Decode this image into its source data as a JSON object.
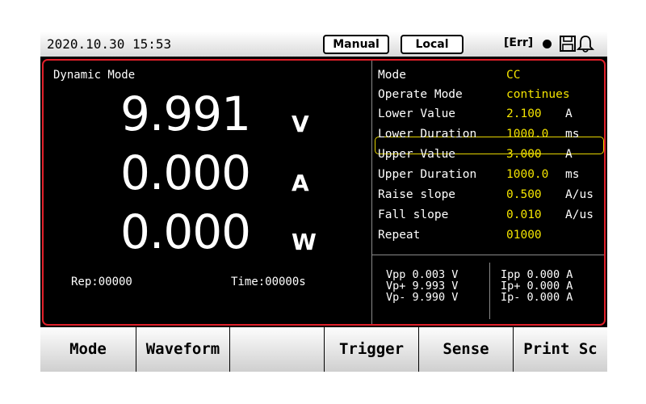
{
  "status_bar": {
    "datetime": "2020.10.30 15:53",
    "control_mode": "Manual",
    "location": "Local",
    "error": "[Err]"
  },
  "panel": {
    "title": "Dynamic Mode",
    "readings": [
      {
        "value": "9.991",
        "unit": "V"
      },
      {
        "value": "0.000",
        "unit": "A"
      },
      {
        "value": "0.000",
        "unit": "W"
      }
    ],
    "rep": "Rep:00000",
    "time": "Time:00000s"
  },
  "params": [
    {
      "label": "Mode",
      "value": "CC",
      "unit": ""
    },
    {
      "label": "Operate Mode",
      "value": "continues",
      "unit": ""
    },
    {
      "label": "Lower Value",
      "value": "2.100",
      "unit": "A"
    },
    {
      "label": "Lower Duration",
      "value": "1000.0",
      "unit": "ms"
    },
    {
      "label": "Upper Value",
      "value": "3.000",
      "unit": "A"
    },
    {
      "label": "Upper Duration",
      "value": "1000.0",
      "unit": "ms"
    },
    {
      "label": "Raise slope",
      "value": "0.500",
      "unit": "A/us"
    },
    {
      "label": "Fall slope",
      "value": "0.010",
      "unit": "A/us"
    },
    {
      "label": "Repeat",
      "value": "01000",
      "unit": ""
    }
  ],
  "selected_param": "Lower Value",
  "measurements": {
    "voltage": [
      "Vpp 0.003 V",
      "Vp+ 9.993 V",
      "Vp- 9.990 V"
    ],
    "current": [
      "Ipp 0.000 A",
      "Ip+ 0.000 A",
      "Ip- 0.000 A"
    ]
  },
  "softkeys": [
    "Mode",
    "Waveform",
    "",
    "Trigger",
    "Sense",
    "Print Sc"
  ],
  "colors": {
    "background": "#000000",
    "panel_border": "#e0202a",
    "value_text": "#f4e400",
    "selection_border": "#e6d500"
  },
  "icons": [
    "status-dot-icon",
    "save-icon",
    "bell-icon"
  ]
}
